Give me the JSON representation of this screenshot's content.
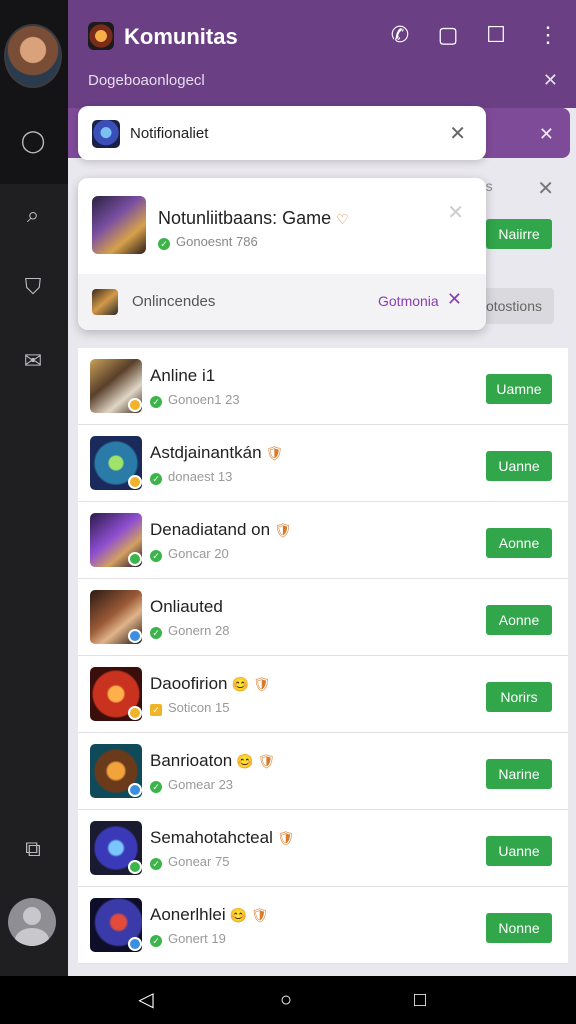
{
  "header": {
    "title": "Komunitas",
    "subtitle": "Dogeboaonlogecl",
    "icons": [
      "call-icon",
      "square-rounded-icon",
      "window-icon",
      "more-icon"
    ]
  },
  "notification_chip": {
    "label": "Notifionaliet"
  },
  "background_panel": {
    "text": "nes",
    "button_label": "Naiirre",
    "option_label": "otostions"
  },
  "card": {
    "title": "Notunliitbaans: Game",
    "status": "Gonoesnt 786",
    "bottom_label": "Onlincendes",
    "bottom_link": "Gotmonia"
  },
  "rows": [
    {
      "title": "Anline i1",
      "emoji": "",
      "status": "Gonoen1 23",
      "button": "Uamne",
      "status_kind": "ok",
      "art": "linear-gradient(140deg,#c9a25a,#5a3f2a 40%,#e0d6c6 70%,#3d2b1f)"
    },
    {
      "title": "Astdjainantkán",
      "emoji": "🛡",
      "status": "donaest 13",
      "button": "Uanne",
      "status_kind": "ok",
      "art": "radial-gradient(circle at 50% 50%,#9fe36a 0 18%,#2a7ba8 22% 55%,#1a2a5a 60%)"
    },
    {
      "title": "Denadiatand on",
      "emoji": "🛡",
      "status": "Goncar 20",
      "button": "Aonne",
      "status_kind": "ok",
      "art": "linear-gradient(140deg,#2c1a4a,#8e4fd0 45%,#d2a060 70%,#1a1030)"
    },
    {
      "title": "Onliauted",
      "emoji": "",
      "status": "Gonern 28",
      "button": "Aonne",
      "status_kind": "ok",
      "art": "linear-gradient(140deg,#2a1a14,#9a5a36 45%,#e0b48a 65%,#1e120e)"
    },
    {
      "title": "Daoofirion",
      "emoji": "😊 🛡",
      "status": "Soticon 15",
      "button": "Norirs",
      "status_kind": "warn",
      "art": "radial-gradient(circle at 50% 50%,#ffb04a 0 20%,#c8321e 25% 60%,#3a0e0a 65%)"
    },
    {
      "title": "Banrioaton",
      "emoji": "😊 🛡",
      "status": "Gomear 23",
      "button": "Narine",
      "status_kind": "ok",
      "art": "radial-gradient(circle at 50% 50%,#f2a33a 0 22%,#6a3a1a 28% 55%,#0e4a5a 60%)"
    },
    {
      "title": "Semahotahcteal",
      "emoji": "🛡",
      "status": "Gonear 75",
      "button": "Uanne",
      "status_kind": "ok",
      "art": "radial-gradient(circle at 50% 50%,#7ac6ff 0 18%,#3a3ab8 24% 55%,#1a1a30 60%)"
    },
    {
      "title": "Aonerlhlei",
      "emoji": "😊 🛡",
      "status": "Gonert 19",
      "button": "Nonne",
      "status_kind": "ok",
      "art": "radial-gradient(circle at 55% 45%,#e24a3a 0 18%,#3a3aa8 24% 55%,#0e0e28 60%)"
    }
  ],
  "navbar": [
    "back-icon",
    "home-icon",
    "recents-icon"
  ]
}
